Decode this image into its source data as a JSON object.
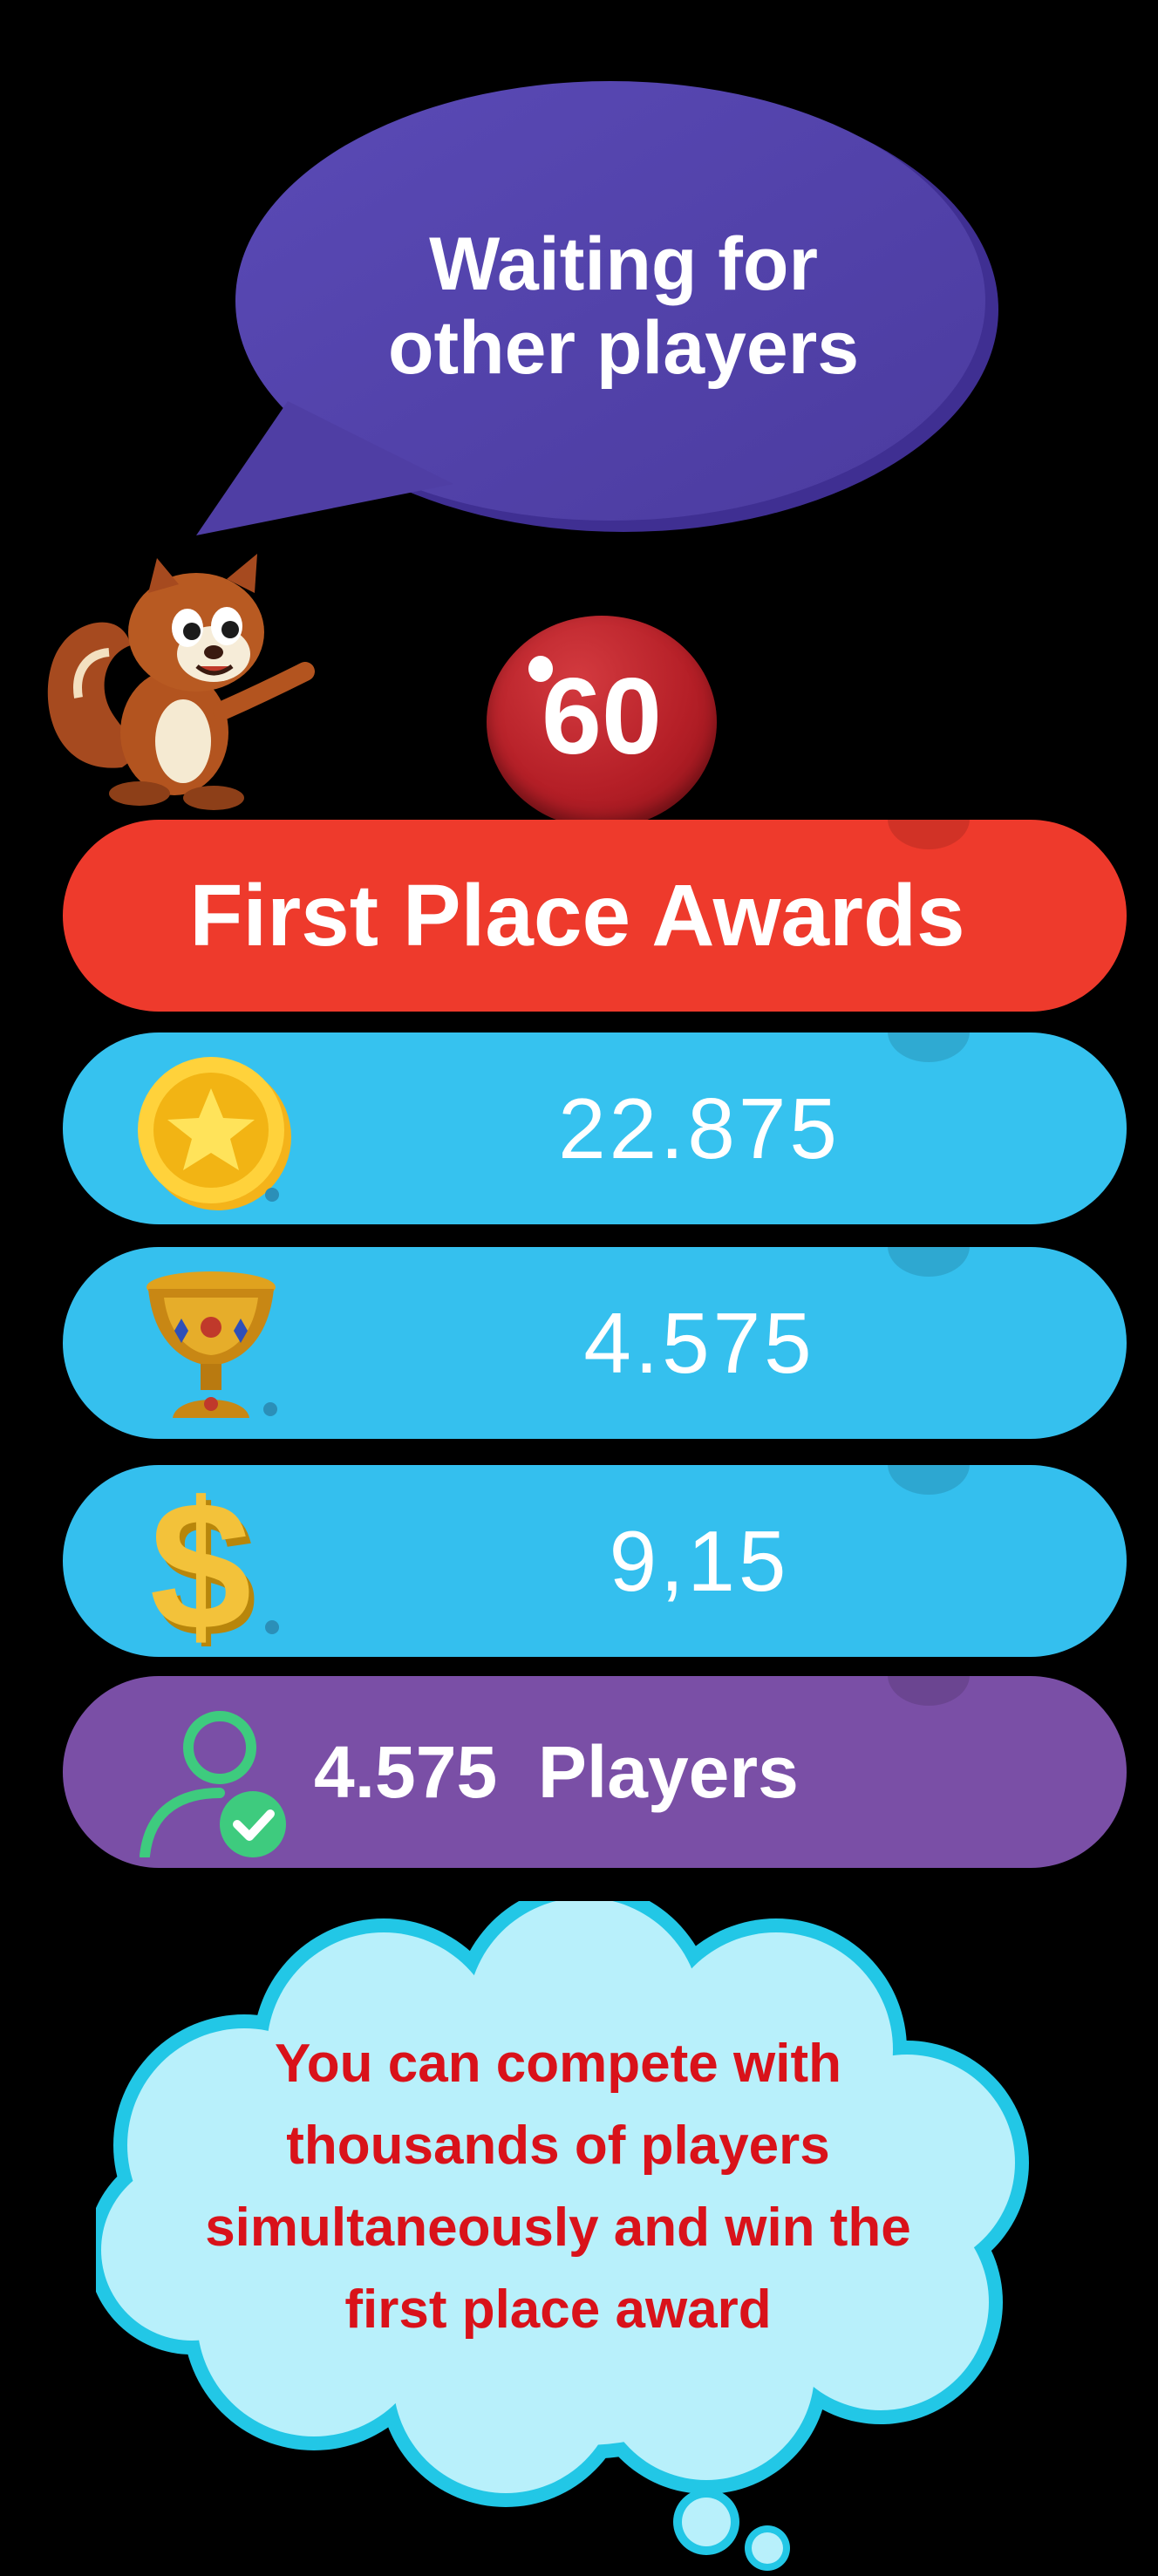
{
  "speech_bubble": {
    "line1": "Waiting for",
    "line2": "other players"
  },
  "timer": {
    "value": "60"
  },
  "awards": {
    "title": "First Place Awards",
    "coins": {
      "value": "22.875",
      "icon": "coin-star-icon"
    },
    "trophy": {
      "value": "4.575",
      "icon": "trophy-icon"
    },
    "dollar": {
      "value": "9,15",
      "icon": "dollar-icon"
    },
    "players": {
      "value": "4.575  Players",
      "icon": "user-check-icon"
    }
  },
  "cloud": {
    "line1": "You can compete with",
    "line2": "thousands of players",
    "line3": "simultaneously and win the",
    "line4": "first place award"
  },
  "colors": {
    "background": "#000000",
    "speech_bubble": "#5b45ad",
    "timer": "#b51f27",
    "awards_title": "#ee3a2c",
    "award_row": "#36c2ef",
    "players_row": "#7a4fa6",
    "cloud": "#b8f0fb",
    "cloud_text": "#d9121a"
  }
}
